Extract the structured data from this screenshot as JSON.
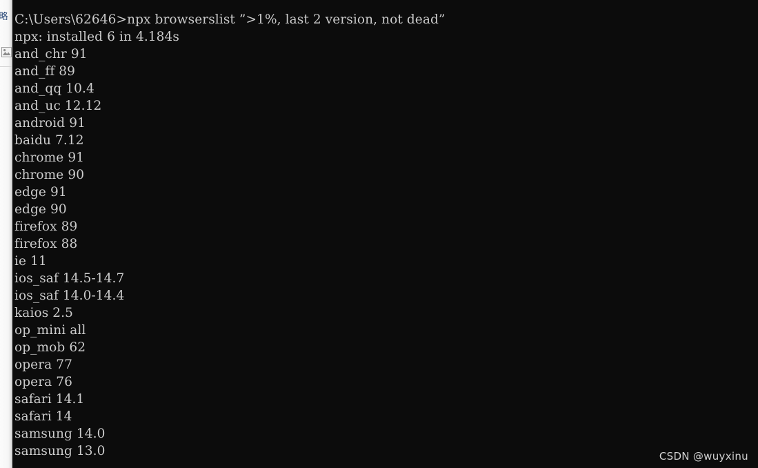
{
  "terminal": {
    "background_color": "#0c0c0c",
    "text_color": "#cbcbcb",
    "prompt_line": "C:\\Users\\62646>npx browserslist ”>1%, last 2 version, not dead”",
    "install_line": "npx: installed 6 in 4.184s",
    "browser_lines": [
      "and_chr 91",
      "and_ff 89",
      "and_qq 10.4",
      "and_uc 12.12",
      "android 91",
      "baidu 7.12",
      "chrome 91",
      "chrome 90",
      "edge 91",
      "edge 90",
      "firefox 89",
      "firefox 88",
      "ie 11",
      "ios_saf 14.5-14.7",
      "ios_saf 14.0-14.4",
      "kaios 2.5",
      "op_mini all",
      "op_mob 62",
      "opera 77",
      "opera 76",
      "safari 14.1",
      "safari 14",
      "samsung 14.0",
      "samsung 13.0"
    ]
  },
  "left_strip": {
    "background_color": "#fbfbfb",
    "clipped_text": "百略",
    "broken_image_icon": "broken-image-icon"
  },
  "watermark": {
    "text": "CSDN @wuyxinu",
    "color": "#d2d2d2"
  }
}
